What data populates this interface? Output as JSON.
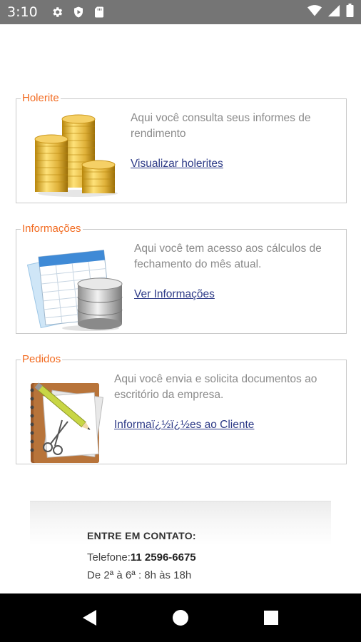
{
  "status_bar": {
    "time": "3:10",
    "left_icons": [
      "gear-icon",
      "play-shield-icon",
      "sd-card-icon"
    ],
    "right_icons": [
      "wifi-icon",
      "signal-icon",
      "battery-icon"
    ]
  },
  "sections": [
    {
      "id": "holerite",
      "legend": "Holerite",
      "illustration": "coin-stacks-icon",
      "text": "Aqui você consulta seus informes de rendimento",
      "link": "Visualizar holerites"
    },
    {
      "id": "informacoes",
      "legend": "Informações",
      "illustration": "spreadsheet-database-icon",
      "text": "Aqui você tem acesso aos cálculos de fechamento do mês atual.",
      "link": "Ver Informações"
    },
    {
      "id": "pedidos",
      "legend": "Pedidos",
      "illustration": "notebook-pencil-scissors-icon",
      "text": "Aqui você envia e solicita documentos ao escritório da empresa.",
      "link": "Informaï¿½ï¿½es ao Cliente"
    }
  ],
  "contact": {
    "title": "ENTRE EM CONTATO:",
    "phone_label": "Telefone:",
    "phone_number": "11 2596-6675",
    "hours": "De 2ª à 6ª : 8h às 18h"
  },
  "nav_bar": {
    "buttons": [
      "back-icon",
      "home-icon",
      "recents-icon"
    ]
  },
  "colors": {
    "legend": "#f26b21",
    "link": "#2d3a87",
    "status_bar": "#757575",
    "nav_bar": "#000000"
  }
}
